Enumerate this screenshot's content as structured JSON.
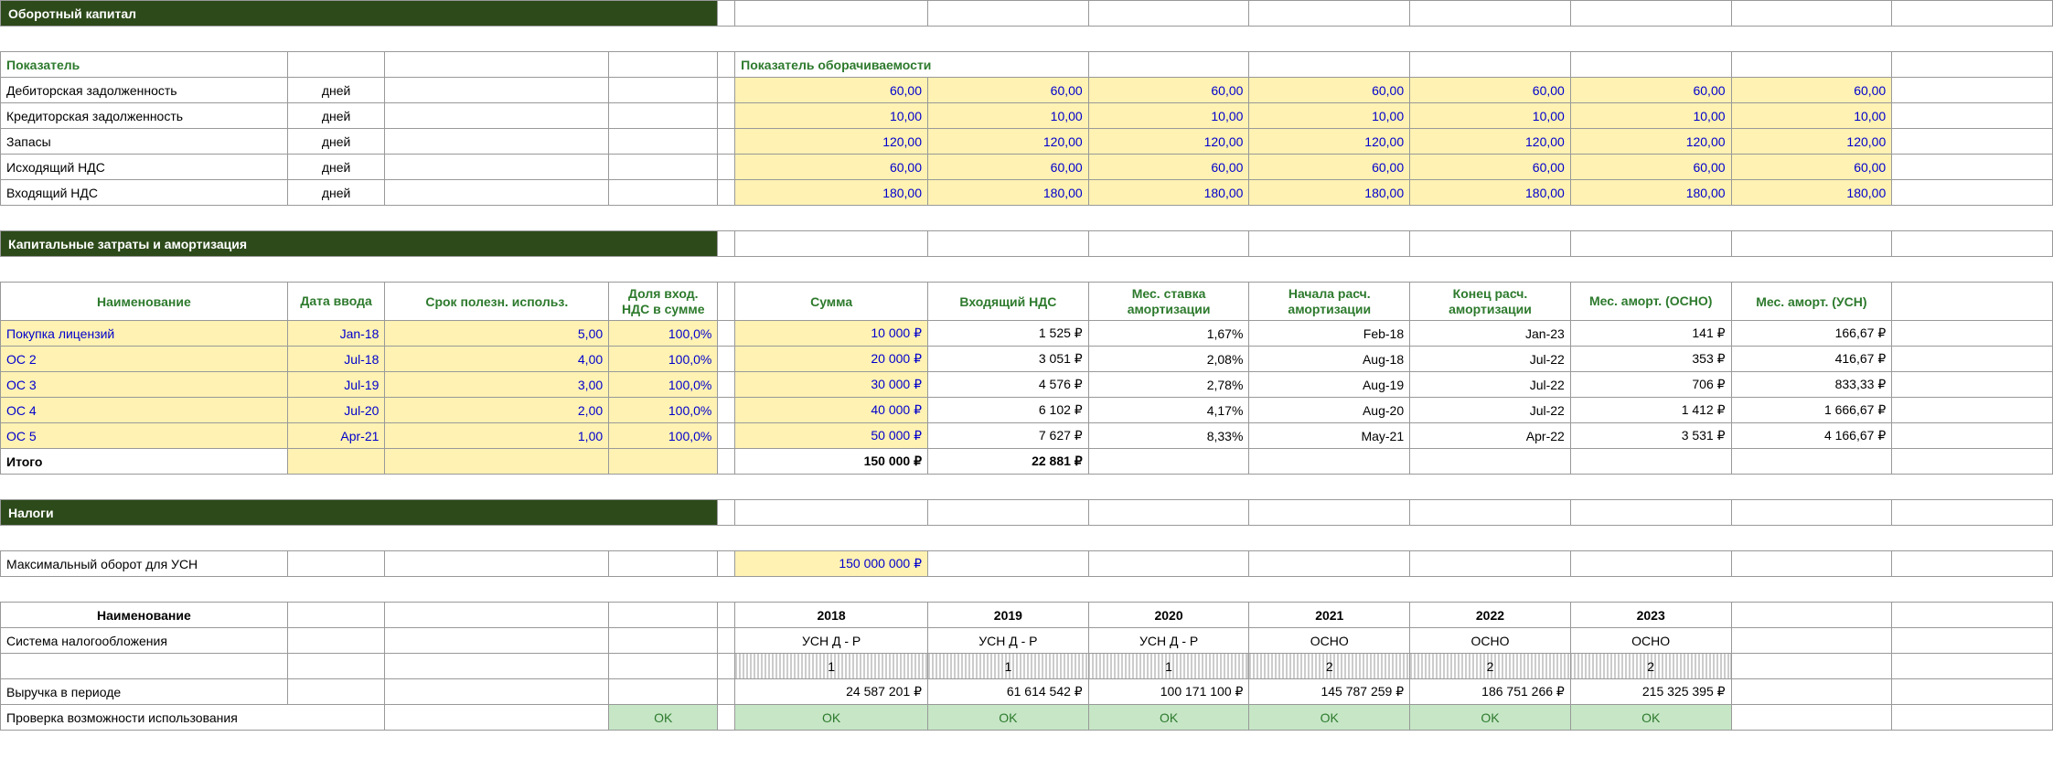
{
  "sections": {
    "working_capital": "Оборотный капитал",
    "capex": "Капитальные затраты и амортизация",
    "taxes": "Налоги"
  },
  "wc": {
    "indicator_label": "Показатель",
    "turnover_label": "Показатель оборачиваемости",
    "rows": [
      {
        "label": "Дебиторская задолженность",
        "unit": "дней",
        "vals": [
          "60,00",
          "60,00",
          "60,00",
          "60,00",
          "60,00",
          "60,00",
          "60,00"
        ]
      },
      {
        "label": "Кредиторская задолженность",
        "unit": "дней",
        "vals": [
          "10,00",
          "10,00",
          "10,00",
          "10,00",
          "10,00",
          "10,00",
          "10,00"
        ]
      },
      {
        "label": "Запасы",
        "unit": "дней",
        "vals": [
          "120,00",
          "120,00",
          "120,00",
          "120,00",
          "120,00",
          "120,00",
          "120,00"
        ]
      },
      {
        "label": "Исходящий НДС",
        "unit": "дней",
        "vals": [
          "60,00",
          "60,00",
          "60,00",
          "60,00",
          "60,00",
          "60,00",
          "60,00"
        ]
      },
      {
        "label": "Входящий НДС",
        "unit": "дней",
        "vals": [
          "180,00",
          "180,00",
          "180,00",
          "180,00",
          "180,00",
          "180,00",
          "180,00"
        ]
      }
    ]
  },
  "capex": {
    "headers": {
      "name": "Наименование",
      "date": "Дата ввода",
      "life": "Срок полезн. использ.",
      "vat_share": "Доля вход. НДС в сумме",
      "sum": "Сумма",
      "in_vat": "Входящий НДС",
      "rate": "Мес. ставка амортизации",
      "start": "Начала расч. амортизации",
      "end": "Конец расч. амортизации",
      "amort_osno": "Мес. аморт. (ОСНО)",
      "amort_usn": "Мес. аморт. (УСН)"
    },
    "rows": [
      {
        "name": "Покупка лицензий",
        "date": "Jan-18",
        "life": "5,00",
        "vat": "100,0%",
        "sum": "10 000 ₽",
        "in_vat": "1 525 ₽",
        "rate": "1,67%",
        "start": "Feb-18",
        "end": "Jan-23",
        "osno": "141 ₽",
        "usn": "166,67 ₽"
      },
      {
        "name": "ОС 2",
        "date": "Jul-18",
        "life": "4,00",
        "vat": "100,0%",
        "sum": "20 000 ₽",
        "in_vat": "3 051 ₽",
        "rate": "2,08%",
        "start": "Aug-18",
        "end": "Jul-22",
        "osno": "353 ₽",
        "usn": "416,67 ₽"
      },
      {
        "name": "ОС 3",
        "date": "Jul-19",
        "life": "3,00",
        "vat": "100,0%",
        "sum": "30 000 ₽",
        "in_vat": "4 576 ₽",
        "rate": "2,78%",
        "start": "Aug-19",
        "end": "Jul-22",
        "osno": "706 ₽",
        "usn": "833,33 ₽"
      },
      {
        "name": "ОС 4",
        "date": "Jul-20",
        "life": "2,00",
        "vat": "100,0%",
        "sum": "40 000 ₽",
        "in_vat": "6 102 ₽",
        "rate": "4,17%",
        "start": "Aug-20",
        "end": "Jul-22",
        "osno": "1 412 ₽",
        "usn": "1 666,67 ₽"
      },
      {
        "name": "ОС 5",
        "date": "Apr-21",
        "life": "1,00",
        "vat": "100,0%",
        "sum": "50 000 ₽",
        "in_vat": "7 627 ₽",
        "rate": "8,33%",
        "start": "May-21",
        "end": "Apr-22",
        "osno": "3 531 ₽",
        "usn": "4 166,67 ₽"
      }
    ],
    "total": {
      "label": "Итого",
      "sum": "150 000 ₽",
      "in_vat": "22 881 ₽"
    }
  },
  "tax": {
    "max_usn_label": "Максимальный оборот для УСН",
    "max_usn_value": "150 000 000 ₽",
    "name_label": "Наименование",
    "years": [
      "2018",
      "2019",
      "2020",
      "2021",
      "2022",
      "2023"
    ],
    "system_label": "Система налогообложения",
    "system_vals": [
      "УСН Д - Р",
      "УСН Д - Р",
      "УСН Д - Р",
      "ОСНО",
      "ОСНО",
      "ОСНО"
    ],
    "hatched_vals": [
      "1",
      "1",
      "1",
      "2",
      "2",
      "2"
    ],
    "revenue_label": "Выручка в периоде",
    "revenue_vals": [
      "24 587 201 ₽",
      "61 614 542 ₽",
      "100 171 100 ₽",
      "145 787 259 ₽",
      "186 751 266 ₽",
      "215 325 395 ₽"
    ],
    "check_label": "Проверка возможности использования",
    "ok": "OK"
  }
}
